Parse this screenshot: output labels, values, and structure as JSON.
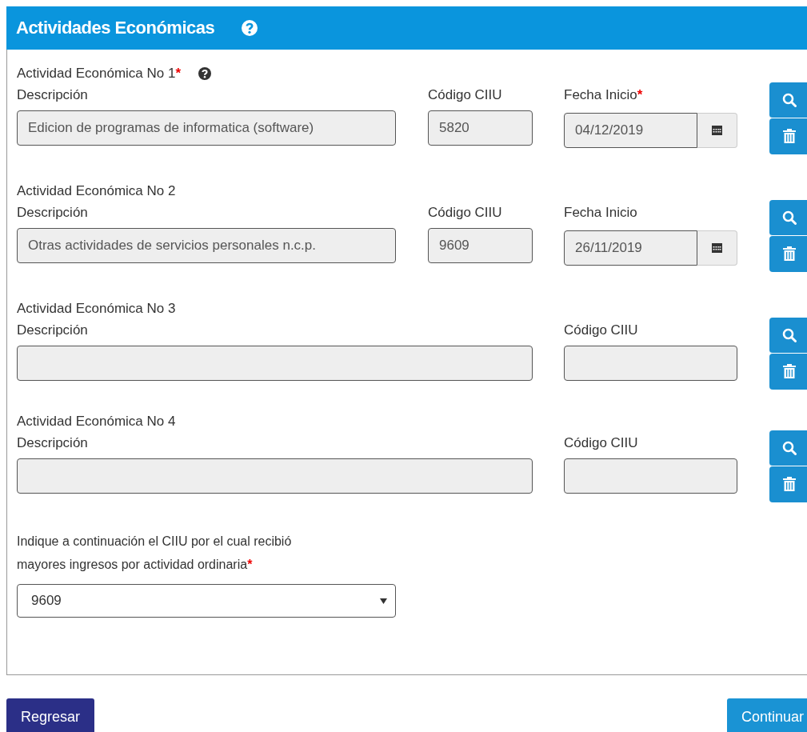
{
  "header": {
    "title": "Actividades Económicas"
  },
  "activities": [
    {
      "kind": "dated",
      "title": "Actividad Económica No 1",
      "required_mark": "*",
      "has_help": true,
      "description": {
        "label": "Descripción",
        "value": "Edicion de programas de informatica (software)"
      },
      "code": {
        "label": "Código CIIU",
        "value": "5820"
      },
      "start_date": {
        "label": "Fecha Inicio",
        "required_mark": "*",
        "value": "04/12/2019"
      }
    },
    {
      "kind": "dated",
      "title": "Actividad Económica No 2",
      "has_help": false,
      "description": {
        "label": "Descripción",
        "value": "Otras actividades de servicios personales n.c.p."
      },
      "code": {
        "label": "Código CIIU",
        "value": "9609"
      },
      "start_date": {
        "label": "Fecha Inicio",
        "value": "26/11/2019"
      }
    },
    {
      "kind": "plain",
      "title": "Actividad Económica No 3",
      "has_help": false,
      "description": {
        "label": "Descripción"
      },
      "code": {
        "label": "Código CIIU"
      }
    },
    {
      "kind": "plain",
      "title": "Actividad Económica No 4",
      "has_help": false,
      "description": {
        "label": "Descripción"
      },
      "code": {
        "label": "Código CIIU"
      }
    }
  ],
  "main_ciiu": {
    "label": "Indique a continuación el CIIU por el cual recibió\nmayores ingresos por actividad ordinaria",
    "required_mark": "*",
    "value": "9609"
  },
  "buttons": {
    "back": "Regresar",
    "continue": "Continuar"
  }
}
